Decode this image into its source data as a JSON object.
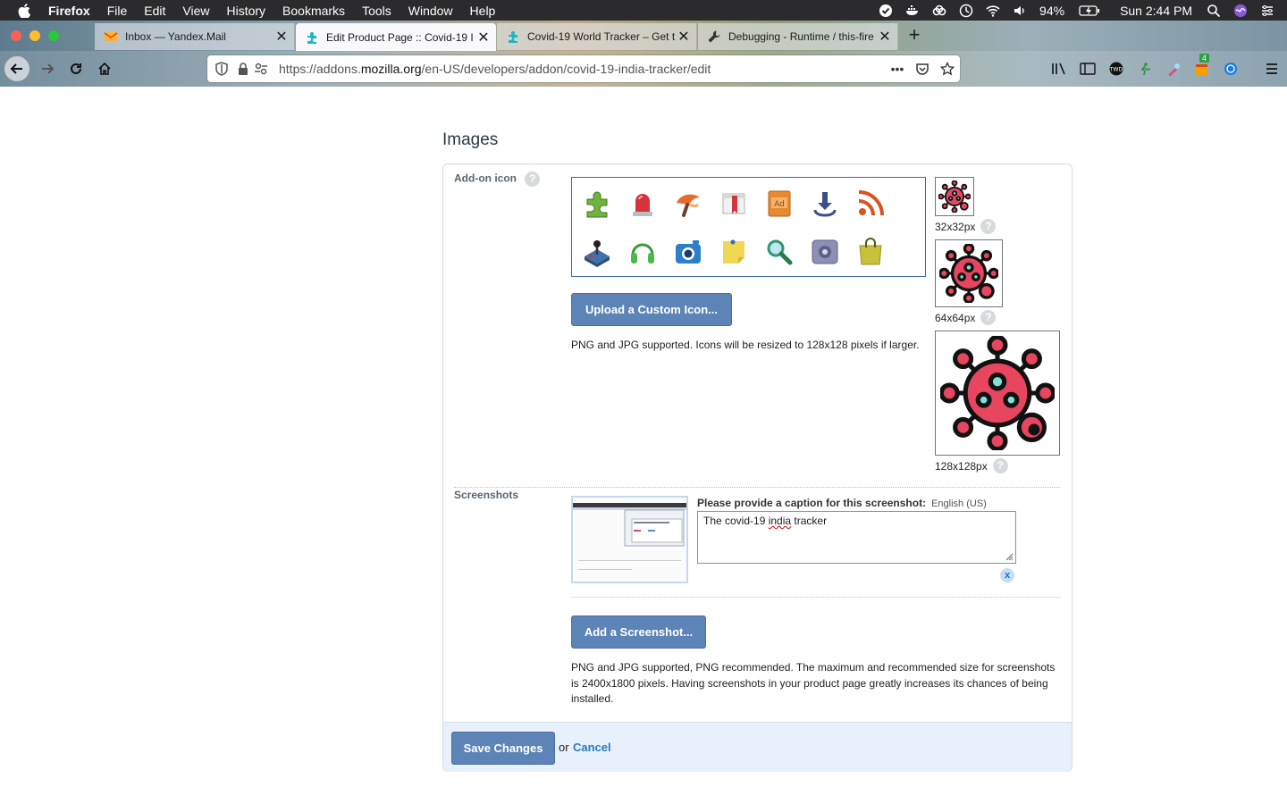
{
  "menubar": {
    "app": "Firefox",
    "items": [
      "File",
      "Edit",
      "View",
      "History",
      "Bookmarks",
      "Tools",
      "Window",
      "Help"
    ],
    "battery": "94%",
    "clock": "Sun 2:44 PM"
  },
  "tabs": [
    {
      "label": "Inbox — Yandex.Mail",
      "icon": "mail-icon"
    },
    {
      "label": "Edit Product Page :: Covid-19 I",
      "icon": "puzzle-icon"
    },
    {
      "label": "Covid-19 World Tracker – Get t",
      "icon": "puzzle-icon"
    },
    {
      "label": "Debugging - Runtime / this-fire",
      "icon": "wrench-icon"
    }
  ],
  "urlbar": {
    "prefix": "https://addons.",
    "domain": "mozilla.org",
    "path": "/en-US/developers/addon/covid-19-india-tracker/edit"
  },
  "toolbar": {
    "badge": "4"
  },
  "page": {
    "heading": "Images",
    "addon_icon_label": "Add-on icon",
    "help_glyph": "?",
    "upload_button": "Upload a Custom Icon...",
    "icon_note": "PNG and JPG supported. Icons will be resized to 128x128 pixels if larger.",
    "sizes": [
      "32x32px",
      "64x64px",
      "128x128px"
    ],
    "screenshots_label": "Screenshots",
    "caption_label": "Please provide a caption for this screenshot:",
    "caption_lang": "English (US)",
    "caption_pre": "The covid-19 ",
    "caption_spell": "india",
    "caption_post": " tracker",
    "remove_glyph": "x",
    "add_screenshot_button": "Add a Screenshot...",
    "screenshot_note": "PNG and JPG supported, PNG recommended. The maximum and recommended size for screenshots is 2400x1800 pixels. Having screenshots in your product page greatly increases its chances of being installed.",
    "save_button": "Save Changes",
    "or_text": "or",
    "cancel_link": "Cancel"
  },
  "colors": {
    "accent_button": "#5c84b6",
    "link": "#2a7ac0",
    "virus": "#e8455f",
    "footer_bg": "#e8f1fb"
  },
  "default_icons": [
    "puzzle-icon",
    "siren-icon",
    "paint-icon",
    "book-icon",
    "dictionary-icon",
    "download-icon",
    "rss-icon",
    "joystick-icon",
    "headphones-icon",
    "camera-icon",
    "sticky-note-icon",
    "magnifier-icon",
    "safe-icon",
    "bag-icon"
  ]
}
